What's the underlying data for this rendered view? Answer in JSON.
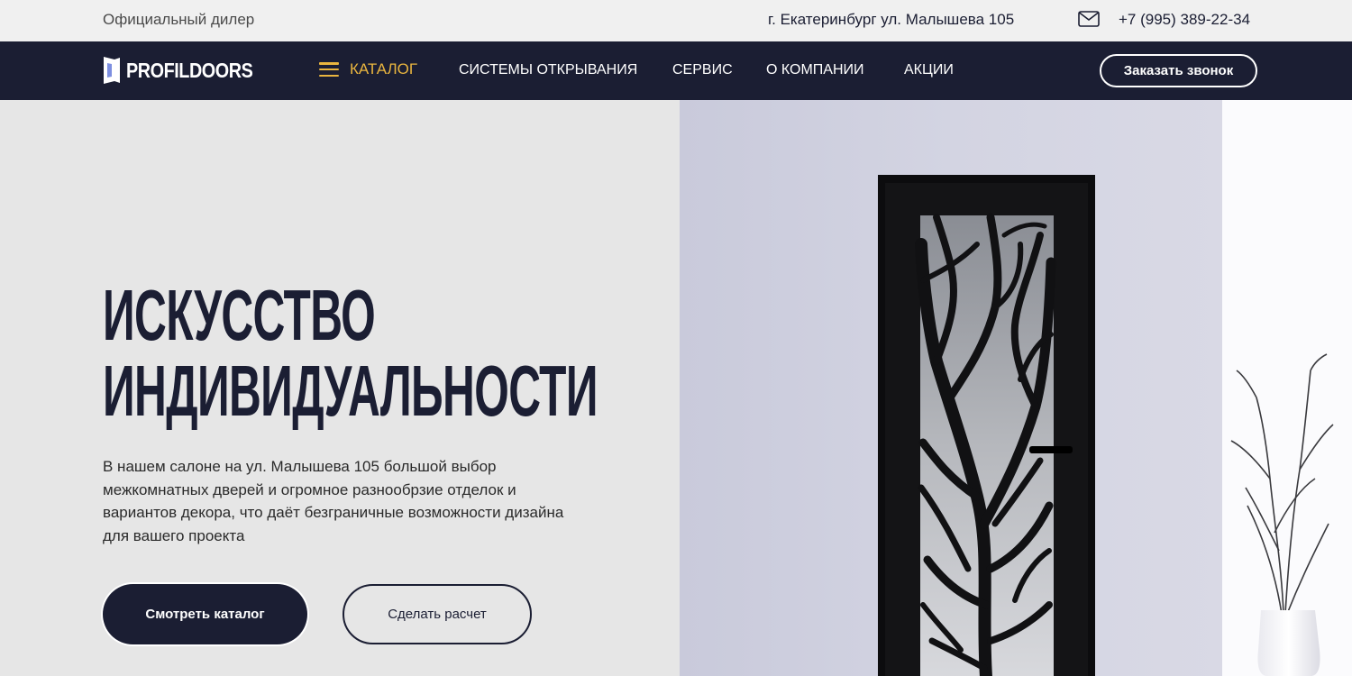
{
  "topbar": {
    "dealer_text": "Официальный дилер",
    "address": "г. Екатеринбург ул. Малышева 105",
    "mail_icon": "envelope-icon",
    "phone": "+7 (995) 389-22-34"
  },
  "navbar": {
    "logo_text": "PROFILDOORS",
    "catalog_label": "КАТАЛОГ",
    "items": [
      "СИСТЕМЫ ОТКРЫВАНИЯ",
      "СЕРВИС",
      "О КОМПАНИИ",
      "АКЦИИ"
    ],
    "callback_label": "Заказать звонок"
  },
  "hero": {
    "title_line1": "ИСКУССТВО",
    "title_line2": "ИНДИВИДУАЛЬНОСТИ",
    "description": "В нашем салоне на ул. Малышева 105 большой выбор межкомнатных дверей и огромное разнообрзие отделок и вариантов декора, что даёт безграничные возможности дизайна для вашего проекта",
    "catalog_button": "Смотреть каталог",
    "calc_button": "Сделать расчет"
  },
  "colors": {
    "navy": "#1b1e33",
    "accent": "#e9b53f",
    "background": "#e6e6e6",
    "wall": "#cfd0dd"
  }
}
